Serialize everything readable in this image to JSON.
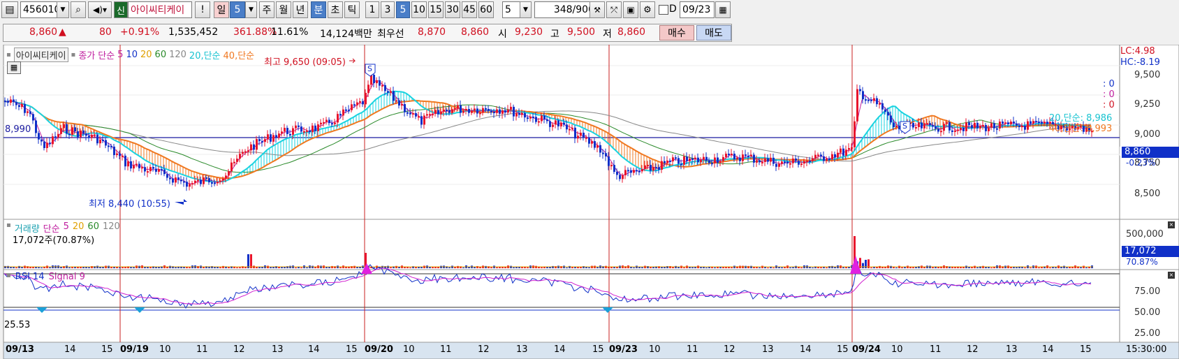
{
  "toolbar": {
    "code": "456010",
    "stock_name": "아이씨티케이",
    "exclaim": "!",
    "period_day": "일",
    "period_num": "5",
    "week": "주",
    "month": "월",
    "year": "년",
    "minute": "분",
    "second": "초",
    "tick": "틱",
    "intervals": [
      "1",
      "3",
      "5",
      "10",
      "15",
      "30",
      "45",
      "60"
    ],
    "count_select": "5",
    "bars": "348",
    "bars_max": "/900",
    "date_checkbox_label": "D",
    "date": "09/23"
  },
  "quote": {
    "price": "8,860",
    "arrow": "▲",
    "change": "80",
    "change_pct": "+0.91%",
    "volume": "1,535,452",
    "ratio1": "361.88%",
    "ratio2": "11.61%",
    "amount": "14,124백만",
    "best_label": "최우선",
    "ask": "8,870",
    "bid": "8,860",
    "open_label": "시",
    "open": "9,230",
    "high_label": "고",
    "high": "9,500",
    "low_label": "저",
    "low": "8,860",
    "buy": "매수",
    "sell": "매도"
  },
  "price_panel": {
    "name": "아이씨티케이",
    "legend_series": "종가",
    "legend_ma": "단순",
    "ma_periods": [
      "5",
      "10",
      "20",
      "60",
      "120"
    ],
    "legend_ma20": "20,단순",
    "legend_ma40": "40,단순",
    "max_label": "최고 9,650 (09:05)",
    "min_label": "최저 8,440 (10:55)",
    "ref_line_value": "8,990",
    "lc": "LC:4.98",
    "hc": "HC:-8.19",
    "y_ticks": [
      "9,500",
      "9,250",
      "9,000",
      "8,750",
      "8,500"
    ],
    "ma20_label": "20,단순: 8,986",
    "ma40_label": "40,단순: 8,993",
    "current_price": "8,860",
    "current_pct": "-0.23%",
    "zero_markers": [
      ": 0",
      ": 0",
      ": 0"
    ],
    "signal_marker": "S"
  },
  "volume_panel": {
    "title": "거래량",
    "legend_ma": "단순",
    "ma_periods": [
      "5",
      "20",
      "60",
      "120"
    ],
    "current_text": "17,072주(70.87%)",
    "y_tick": "500,000",
    "current_value": "17,072",
    "current_pct": "70.87%"
  },
  "rsi_panel": {
    "title": "RSI 14",
    "signal": "Signal 9",
    "left_value": "25.53",
    "y_ticks": [
      "75.00",
      "50.00",
      "25.00"
    ]
  },
  "x_axis": {
    "labels": [
      "09/13",
      "14",
      "15",
      "09/19",
      "10",
      "11",
      "12",
      "13",
      "14",
      "15",
      "09/20",
      "10",
      "11",
      "12",
      "13",
      "14",
      "15",
      "09/23",
      "10",
      "11",
      "12",
      "13",
      "14",
      "15",
      "09/24",
      "10",
      "11",
      "12",
      "13",
      "14",
      "15"
    ],
    "bold": [
      "09/13",
      "09/19",
      "09/20",
      "09/23",
      "09/24"
    ],
    "time": "15:30:00"
  },
  "colors": {
    "up": "#e8142c",
    "down": "#1030c8",
    "ma20": "#19d3e0",
    "ma40": "#f07820",
    "ma60": "#2a8a2a",
    "ma120": "#888888",
    "ref": "#1a1aa0",
    "session": "#c82020"
  }
}
